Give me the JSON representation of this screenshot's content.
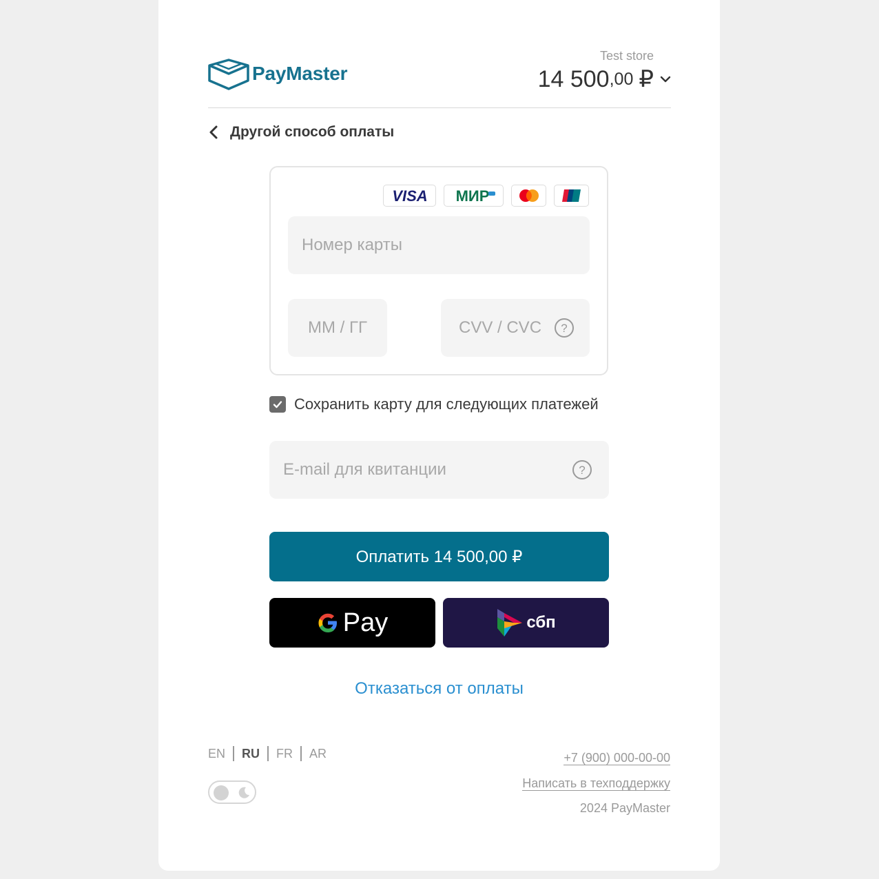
{
  "header": {
    "brand_name": "PayMaster",
    "store_name": "Test store",
    "amount_integer": "14 500",
    "amount_decimal": ",00",
    "currency": "₽"
  },
  "back": {
    "label": "Другой способ оплаты"
  },
  "card_form": {
    "brands": [
      "VISA",
      "МИР",
      "Mastercard",
      "UnionPay"
    ],
    "card_number_placeholder": "Номер карты",
    "expiry_placeholder": "ММ / ГГ",
    "cvv_placeholder": "CVV / CVC"
  },
  "save_card": {
    "label": "Сохранить карту для следующих платежей",
    "checked": true
  },
  "email": {
    "placeholder": "E-mail для квитанции"
  },
  "buttons": {
    "pay_label": "Оплатить 14 500,00 ₽",
    "gpay_label": "Pay",
    "sbp_label": "сбп"
  },
  "cancel_label": "Отказаться от оплаты",
  "footer": {
    "languages": [
      "EN",
      "RU",
      "FR",
      "AR"
    ],
    "active_language": "RU",
    "phone": "+7 (900) 000-00-00",
    "support_label": "Написать в техподдержку",
    "copyright": "2024 PayMaster"
  },
  "colors": {
    "brand": "#17728f",
    "pay_button": "#046f8c",
    "sbp_button": "#1f1645",
    "link": "#2a8fd0"
  }
}
